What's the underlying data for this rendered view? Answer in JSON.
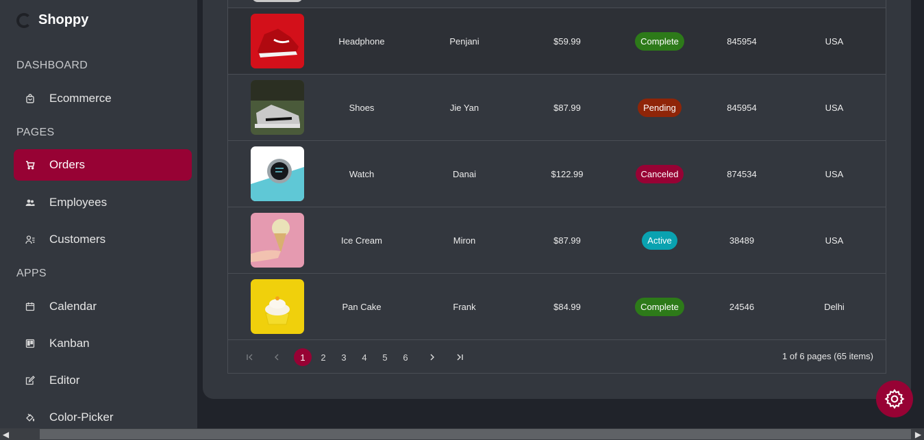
{
  "brand": {
    "name": "Shoppy"
  },
  "sidebar": {
    "sections": {
      "dashboard": "DASHBOARD",
      "pages": "PAGES",
      "apps": "APPS"
    },
    "items": [
      {
        "label": "Ecommerce",
        "icon": "shopping-bag-icon"
      },
      {
        "label": "Orders",
        "icon": "cart-icon",
        "active": true
      },
      {
        "label": "Employees",
        "icon": "employees-icon"
      },
      {
        "label": "Customers",
        "icon": "customers-icon"
      },
      {
        "label": "Calendar",
        "icon": "calendar-icon"
      },
      {
        "label": "Kanban",
        "icon": "kanban-icon"
      },
      {
        "label": "Editor",
        "icon": "edit-icon"
      },
      {
        "label": "Color-Picker",
        "icon": "paint-bucket-icon"
      }
    ]
  },
  "orders": {
    "rows": [
      {
        "image": "red-sneaker",
        "item": "Headphone",
        "customer": "Penjani",
        "amount": "$59.99",
        "status": "Complete",
        "status_color": "#2d7a19",
        "order_id": "845954",
        "location": "USA"
      },
      {
        "image": "grey-shoes",
        "item": "Shoes",
        "customer": "Jie Yan",
        "amount": "$87.99",
        "status": "Pending",
        "status_color": "#8f2508",
        "order_id": "845954",
        "location": "USA"
      },
      {
        "image": "smart-watch",
        "item": "Watch",
        "customer": "Danai",
        "amount": "$122.99",
        "status": "Canceled",
        "status_color": "#970234",
        "order_id": "874534",
        "location": "USA"
      },
      {
        "image": "ice-cream-cone",
        "item": "Ice Cream",
        "customer": "Miron",
        "amount": "$87.99",
        "status": "Active",
        "status_color": "#0aa2b0",
        "order_id": "38489",
        "location": "USA"
      },
      {
        "image": "cupcake",
        "item": "Pan Cake",
        "customer": "Frank",
        "amount": "$84.99",
        "status": "Complete",
        "status_color": "#2d7a19",
        "order_id": "24546",
        "location": "Delhi"
      }
    ]
  },
  "pager": {
    "pages": [
      "1",
      "2",
      "3",
      "4",
      "5",
      "6"
    ],
    "current": "1",
    "info": "1 of 6 pages (65 items)",
    "first_icon": "first-page-icon",
    "prev_icon": "prev-page-icon",
    "next_icon": "next-page-icon",
    "last_icon": "last-page-icon"
  },
  "settings": {
    "icon": "gear-icon"
  },
  "colors": {
    "accent": "#970234",
    "sidebar_bg": "#33373e",
    "page_bg": "#20232a"
  }
}
